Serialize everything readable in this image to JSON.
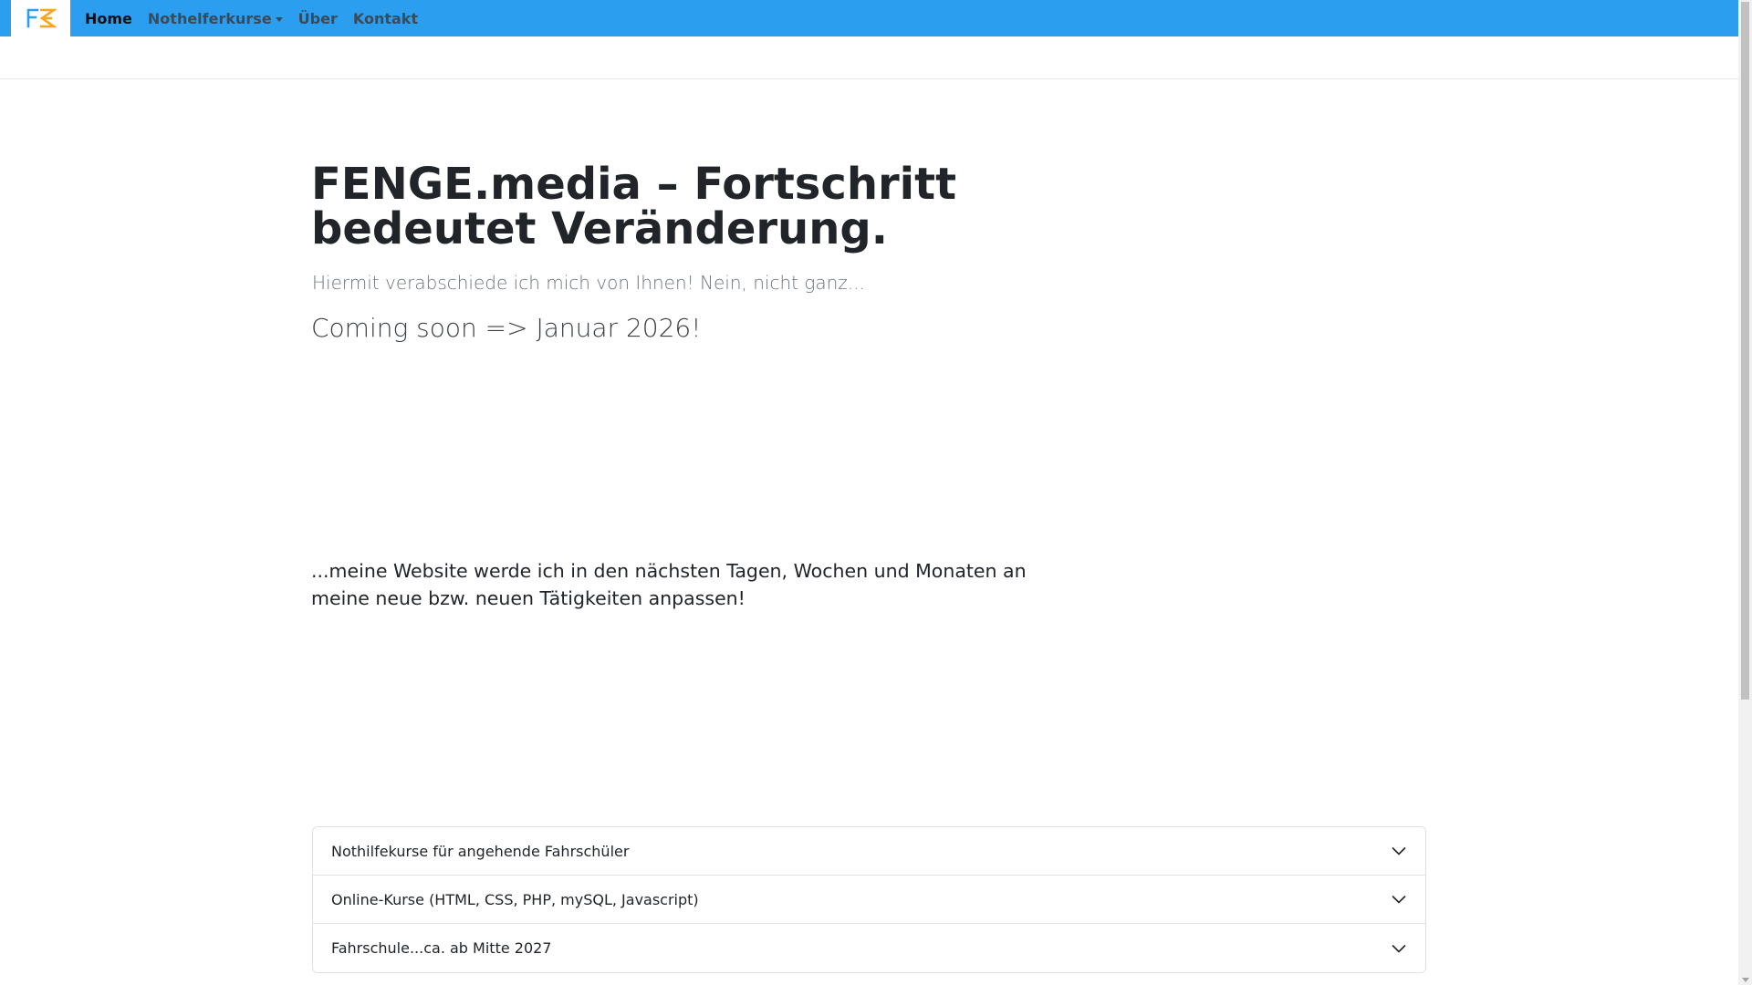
{
  "nav": {
    "brand_icon": "fenge-logo-icon",
    "items": [
      {
        "label": "Home",
        "active": true
      },
      {
        "label": "Nothelferkurse",
        "dropdown": true
      },
      {
        "label": "Über"
      },
      {
        "label": "Kontakt"
      }
    ]
  },
  "hero": {
    "title": "FENGE.media – Fortschritt bedeutet Veränderung.",
    "subtitle": "Hiermit verabschiede ich mich von Ihnen! Nein, nicht ganz...",
    "coming_soon": "Coming soon => Januar 2026!",
    "note": "...meine Website werde ich in den nächsten Tagen, Wochen und Monaten an meine neue bzw. neuen Tätigkeiten anpassen!"
  },
  "accordion": {
    "items": [
      {
        "label": "Nothilfekurse für angehende Fahrschüler",
        "icon": "chevron-down-icon"
      },
      {
        "label": "Online-Kurse (HTML, CSS, PHP, mySQL, Javascript)",
        "icon": "chevron-down-icon"
      },
      {
        "label": "Fahrschule...ca. ab Mitte 2027",
        "icon": "chevron-down-icon"
      }
    ]
  },
  "colors": {
    "navbar": "#2b9ef0",
    "logo_blue": "#2b9ef0",
    "logo_orange": "#f5a623"
  }
}
